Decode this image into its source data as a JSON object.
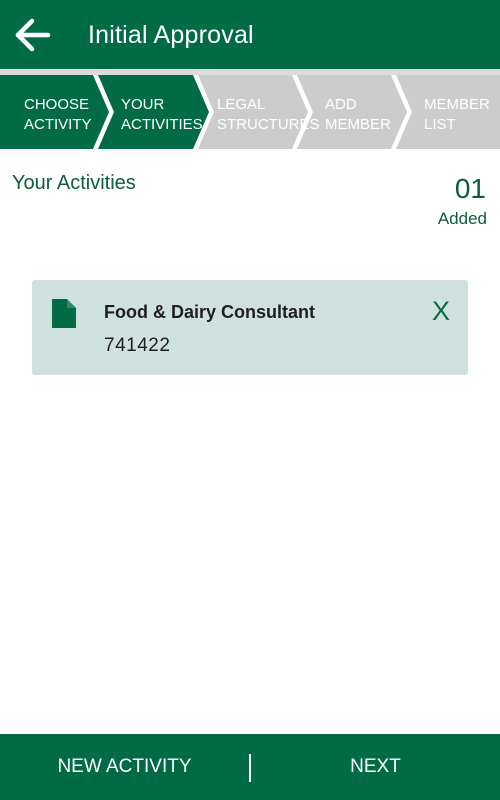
{
  "appbar": {
    "title": "Initial Approval",
    "back_icon": "arrow-left-icon",
    "color": "#006b44"
  },
  "stepper": {
    "active_color": "#006b44",
    "inactive_color": "#cccccc",
    "steps": [
      {
        "label": "CHOOSE\nACTIVITY",
        "state": "completed"
      },
      {
        "label": "YOUR\nACTIVITIES",
        "state": "active"
      },
      {
        "label": "LEGAL\nSTRUCTURES",
        "state": "inactive"
      },
      {
        "label": "ADD\nMEMBER",
        "state": "inactive"
      },
      {
        "label": "MEMBER\nLIST",
        "state": "inactive"
      }
    ]
  },
  "section": {
    "title": "Your Activities",
    "count": "01",
    "count_label": "Added"
  },
  "activities": [
    {
      "icon": "document-icon",
      "name": "Food & Dairy Consultant",
      "code": "741422",
      "remove_label": "X"
    }
  ],
  "bottom_bar": {
    "new_activity_label": "NEW ACTIVITY",
    "next_label": "NEXT"
  }
}
